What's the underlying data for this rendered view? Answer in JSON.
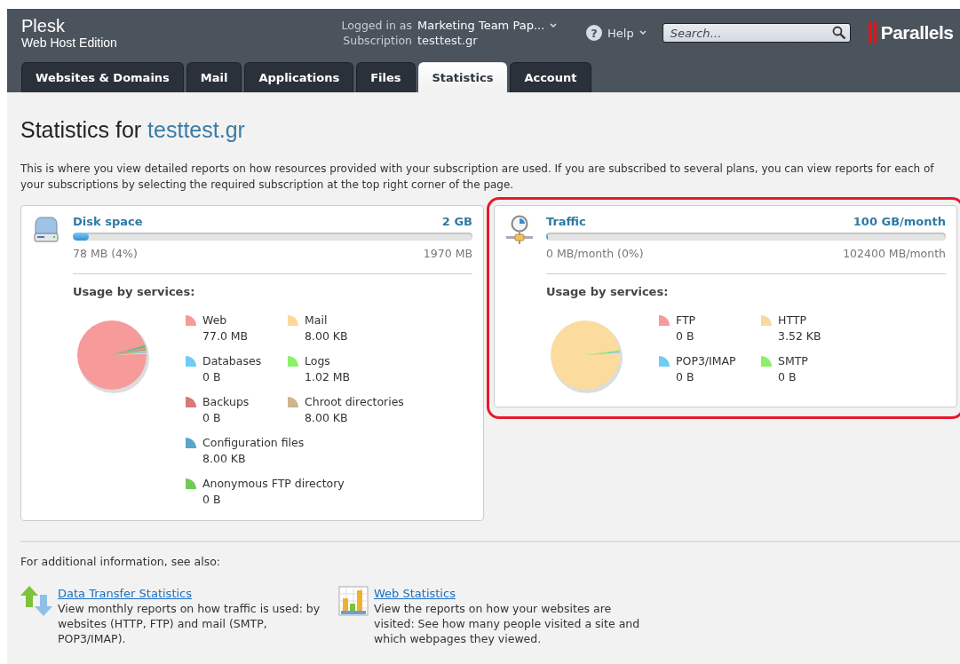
{
  "header": {
    "product": "Plesk",
    "edition": "Web Host Edition",
    "logged_in_label": "Logged in as",
    "logged_in_user": "Marketing Team Pap...",
    "subscription_label": "Subscription",
    "subscription": "testtest.gr",
    "help_icon": "?",
    "help": "Help",
    "search": {
      "placeholder": "Search…"
    },
    "logo": "Parallels"
  },
  "tabs": [
    {
      "label": "Websites & Domains",
      "selected": false
    },
    {
      "label": "Mail",
      "selected": false
    },
    {
      "label": "Applications",
      "selected": false
    },
    {
      "label": "Files",
      "selected": false
    },
    {
      "label": "Statistics",
      "selected": true
    },
    {
      "label": "Account",
      "selected": false
    }
  ],
  "page": {
    "title_prefix": "Statistics for",
    "title_domain": "testtest.gr",
    "description": "This is where you view detailed reports on how resources provided with your subscription are used. If you are subscribed to several plans, you can view reports for each of your subscriptions by selecting the required subscription at the top right corner of the page."
  },
  "cards": [
    {
      "kind": "disk",
      "highlighted": false,
      "title": "Disk space",
      "limit": "2 GB",
      "level": 0.04,
      "used": "78 MB (4%)",
      "total": "1970 MB",
      "usage_title": "Usage by services:",
      "pie": {
        "color": "#f79a9a"
      },
      "legend_rows": [
        [
          {
            "name": "Web",
            "value": "77.0 MB",
            "color": "#f79a9a"
          },
          {
            "name": "Mail",
            "value": "8.00 KB",
            "color": "#fbd99b"
          }
        ],
        [
          {
            "name": "Databases",
            "value": "0 B",
            "color": "#6fcdf5"
          },
          {
            "name": "Logs",
            "value": "1.02 MB",
            "color": "#8cf06a"
          }
        ],
        [
          {
            "name": "Backups",
            "value": "0 B",
            "color": "#d97878"
          },
          {
            "name": "Chroot directories",
            "value": "8.00 KB",
            "color": "#cdb68a"
          }
        ],
        [
          {
            "name": "Configuration files",
            "value": "8.00 KB",
            "color": "#5aa5cc"
          }
        ],
        [
          {
            "name": "Anonymous FTP directory",
            "value": "0 B",
            "color": "#72c95a"
          }
        ]
      ]
    },
    {
      "kind": "traffic",
      "highlighted": true,
      "title": "Traffic",
      "limit": "100 GB/month",
      "level": 0,
      "used": "0 MB/month (0%)",
      "total": "102400 MB/month",
      "usage_title": "Usage by services:",
      "pie": {
        "color": "#fbdc9e"
      },
      "legend_rows": [
        [
          {
            "name": "FTP",
            "value": "0 B",
            "color": "#f79a9a"
          },
          {
            "name": "HTTP",
            "value": "3.52 KB",
            "color": "#fbd99b"
          }
        ],
        [
          {
            "name": "POP3/IMAP",
            "value": "0 B",
            "color": "#6fcdf5"
          },
          {
            "name": "SMTP",
            "value": "0 B",
            "color": "#8cf06a"
          }
        ]
      ]
    }
  ],
  "see_also": {
    "intro": "For additional information, see also:",
    "links": [
      {
        "kind": "transfer",
        "title": "Data Transfer Statistics",
        "description": "View monthly reports on how traffic is used: by websites (HTTP, FTP) and mail (SMTP, POP3/IMAP)."
      },
      {
        "kind": "web",
        "title": "Web Statistics",
        "description": "View the reports on how your websites are visited: See how many people visited a site and which webpages they viewed."
      }
    ]
  }
}
